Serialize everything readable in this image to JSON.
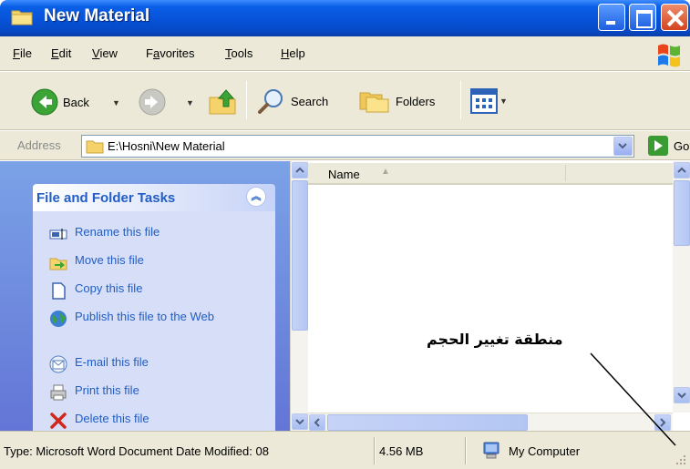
{
  "window": {
    "title": "New Material",
    "icon": "folder-icon"
  },
  "menu": {
    "items": [
      {
        "label_u": "F",
        "label_rest": "ile"
      },
      {
        "label_u": "E",
        "label_rest": "dit"
      },
      {
        "label_u": "V",
        "label_rest": "iew"
      },
      {
        "label_pre": "F",
        "label_u": "a",
        "label_rest": "vorites"
      },
      {
        "label_u": "T",
        "label_rest": "ools"
      },
      {
        "label_u": "H",
        "label_rest": "elp"
      }
    ]
  },
  "toolbar": {
    "back_label": "Back",
    "search_label": "Search",
    "folders_label": "Folders"
  },
  "address": {
    "label": "Address",
    "value": "E:\\Hosni\\New Material",
    "go_label": "Go"
  },
  "tasks": {
    "title": "File and Folder Tasks",
    "items": [
      {
        "label": "Rename this file",
        "icon": "rename-icon"
      },
      {
        "label": "Move this file",
        "icon": "move-icon"
      },
      {
        "label": "Copy this file",
        "icon": "copy-icon"
      },
      {
        "label": "Publish this file to the Web",
        "icon": "globe-icon"
      },
      {
        "label": "E-mail this file",
        "icon": "email-icon"
      },
      {
        "label": "Print this file",
        "icon": "printer-icon"
      },
      {
        "label": "Delete this file",
        "icon": "delete-icon"
      }
    ]
  },
  "filelist": {
    "column_name": "Name"
  },
  "status": {
    "type_text": "Type: Microsoft Word Document Date Modified: 08",
    "size_text": "4.56 MB",
    "zone_text": "My Computer"
  },
  "annotation": {
    "text": "منطقة تغيير الحجم"
  },
  "colors": {
    "title_blue": "#0752d8",
    "task_link": "#215dc6",
    "task_bg": "#d6dff7",
    "chrome": "#ece9d8"
  }
}
